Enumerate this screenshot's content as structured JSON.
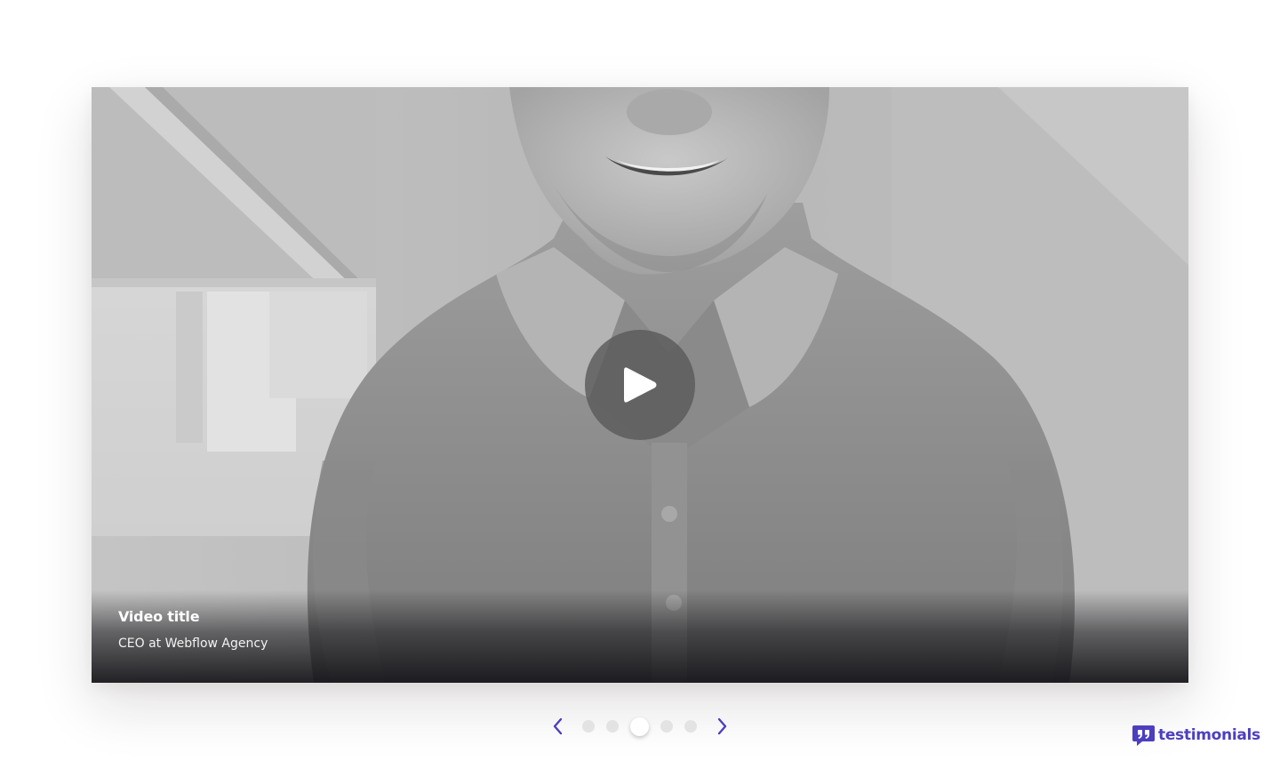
{
  "video": {
    "title": "Video title",
    "subtitle": "CEO at Webflow Agency"
  },
  "carousel": {
    "slides": 5,
    "active_index": 2,
    "prev_icon": "chevron-left-icon",
    "next_icon": "chevron-right-icon"
  },
  "brand": {
    "name": "testimonials",
    "color": "#4c3fbf"
  },
  "colors": {
    "accent": "#4c3fbf",
    "dot_inactive": "#e3e3e3",
    "dot_active": "#ffffff"
  }
}
